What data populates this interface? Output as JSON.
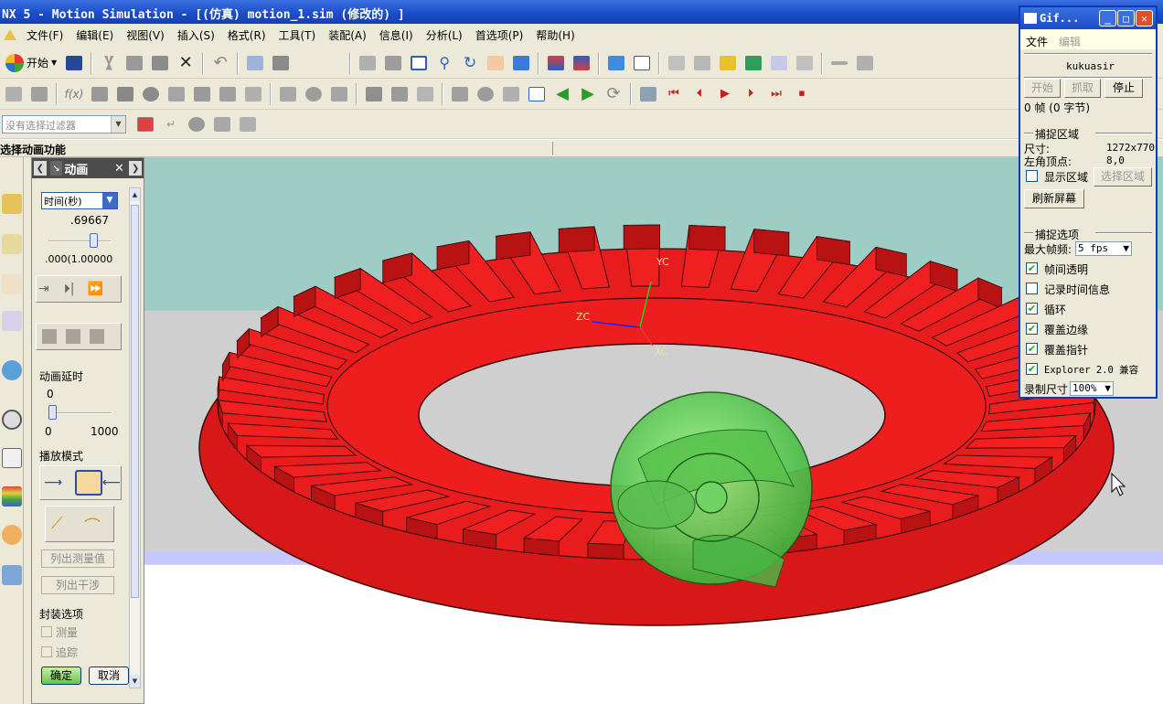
{
  "window": {
    "title": "NX 5 - Motion Simulation - [(仿真) motion_1.sim (修改的) ]"
  },
  "menu": [
    "文件(F)",
    "编辑(E)",
    "视图(V)",
    "插入(S)",
    "格式(R)",
    "工具(T)",
    "装配(A)",
    "信息(I)",
    "分析(L)",
    "首选项(P)",
    "帮助(H)"
  ],
  "toolbar": {
    "start_label": "开始",
    "filter_placeholder": "没有选择过滤器"
  },
  "hint": "选择动画功能",
  "panel": {
    "title": "动画",
    "time_unit": "时间(秒)",
    "time_value": ".69667",
    "time_range": ".000(1.00000",
    "time_fraction": 0.6967,
    "delay_label": "动画延时",
    "delay_value": "0",
    "delay_min": "0",
    "delay_max": "1000",
    "play_mode_label": "播放模式",
    "list_measure": "列出测量值",
    "list_interference": "列出干涉",
    "encap_label": "封装选项",
    "measure": "测量",
    "trace": "追踪",
    "ok": "确定",
    "cancel": "取消"
  },
  "axes": {
    "yc": "YC",
    "zc": "ZC",
    "xc": "XC"
  },
  "gif": {
    "title": "Gif...",
    "menu_file": "文件",
    "menu_edit": "编辑",
    "author": "kukuasir",
    "btn_start": "开始",
    "btn_capture": "抓取",
    "btn_stop": "停止",
    "frame_info": "0 帧 (0 字节)",
    "capture_area": "捕捉区域",
    "size_label": "尺寸:",
    "size_value": "1272x770",
    "corner_label": "左角顶点:",
    "corner_value": "8,0",
    "show_area": "显示区域",
    "select_area": "选择区域",
    "refresh": "刷新屏幕",
    "capture_options": "捕捉选项",
    "max_fps_label": "最大帧频:",
    "max_fps": "5 fps",
    "opt_transparent": "帧间透明",
    "opt_timeinfo": "记录时间信息",
    "opt_loop": "循环",
    "opt_edge": "覆盖边缘",
    "opt_pointer": "覆盖指针",
    "opt_explorer": "Explorer 2.0 兼容",
    "rec_size_label": "录制尺寸",
    "rec_size": "100%"
  }
}
